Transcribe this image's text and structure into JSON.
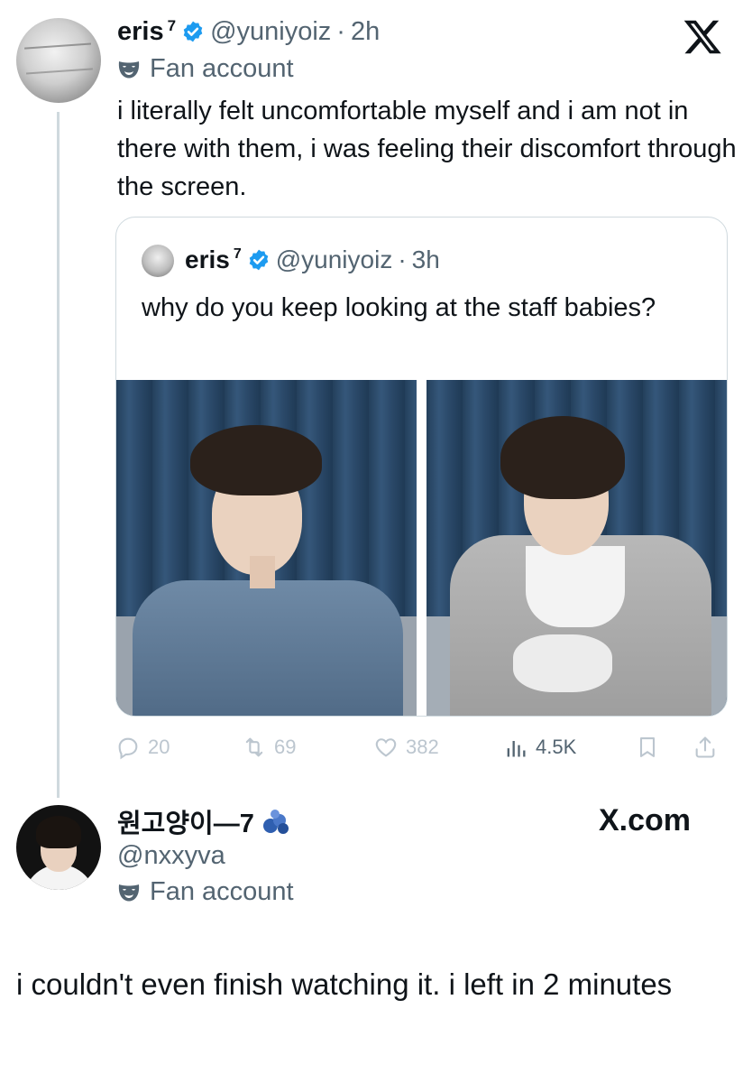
{
  "tweet": {
    "display_name": "eris",
    "name_superscript": "7",
    "handle": "@yuniyoiz",
    "separator": "·",
    "time": "2h",
    "label": "Fan account",
    "text": "i literally felt uncomfortable myself and i am not in there with them, i was feeling their discomfort through the screen."
  },
  "quoted": {
    "display_name": "eris",
    "name_superscript": "7",
    "handle": "@yuniyoiz",
    "separator": "·",
    "time": "3h",
    "text": "why do you keep looking at the staff babies?"
  },
  "stats": {
    "replies": "20",
    "reposts": "69",
    "likes": "382",
    "views": "4.5K"
  },
  "reply": {
    "display_name": "원고양이—7",
    "handle": "@nxxyva",
    "label": "Fan account",
    "text": "i couldn't even finish watching it. i left in 2 minutes"
  },
  "brand": {
    "site": "X.com"
  },
  "colors": {
    "verified": "#1d9bf0",
    "secondary_text": "#536471",
    "divider": "#cfd9de"
  },
  "icons": [
    "x-logo-icon",
    "verified-icon",
    "mask-icon",
    "reply-icon",
    "repost-icon",
    "like-icon",
    "views-icon",
    "bookmark-icon",
    "share-icon",
    "blue-hearts-emoji-icon"
  ]
}
